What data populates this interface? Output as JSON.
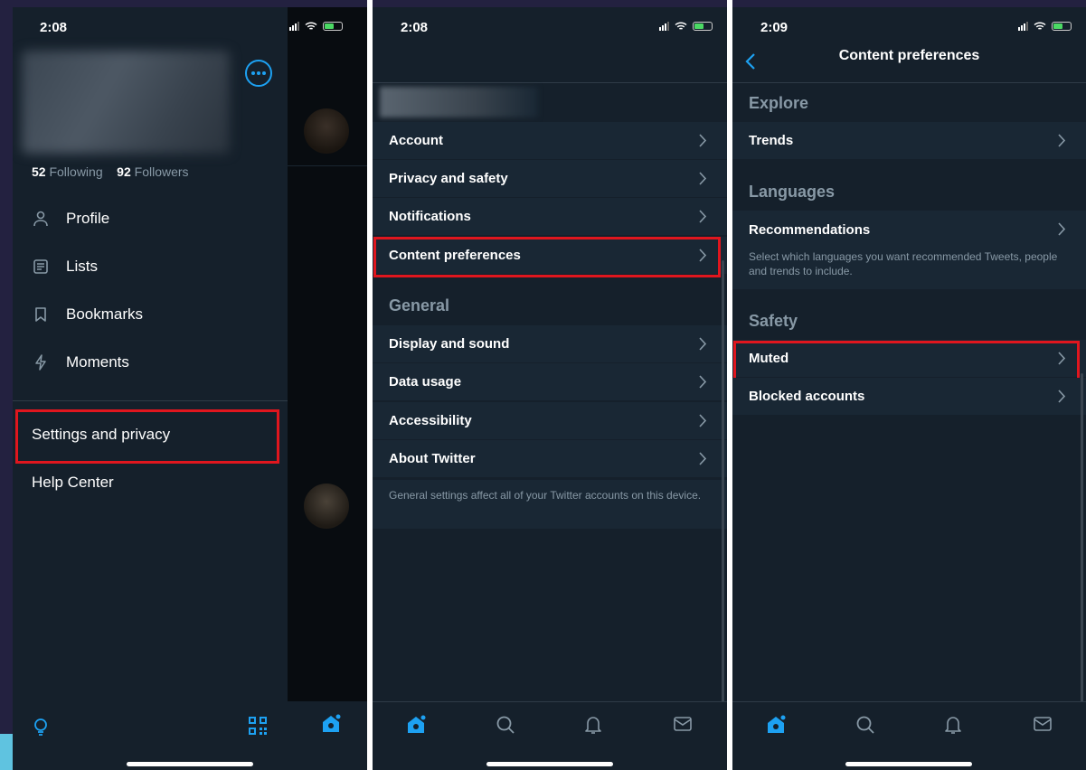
{
  "colors": {
    "background": "#15202b",
    "row": "#192734",
    "accent": "#1da1f2",
    "highlight": "#e0161e",
    "muted_text": "#8899a6"
  },
  "panel1": {
    "time": "2:08",
    "following_count": "52",
    "following_label": "Following",
    "followers_count": "92",
    "followers_label": "Followers",
    "menu": [
      {
        "label": "Profile",
        "icon": "person-icon"
      },
      {
        "label": "Lists",
        "icon": "list-icon"
      },
      {
        "label": "Bookmarks",
        "icon": "bookmark-icon"
      },
      {
        "label": "Moments",
        "icon": "lightning-icon"
      }
    ],
    "settings_label": "Settings and privacy",
    "help_label": "Help Center",
    "bottom_icons": [
      "lightbulb-icon",
      "qr-code-icon"
    ]
  },
  "panel2": {
    "time": "2:08",
    "rows": [
      {
        "label": "Account"
      },
      {
        "label": "Privacy and safety"
      },
      {
        "label": "Notifications"
      },
      {
        "label": "Content preferences"
      }
    ],
    "general_header": "General",
    "general_rows": [
      {
        "label": "Display and sound"
      },
      {
        "label": "Data usage"
      },
      {
        "label": "Accessibility"
      },
      {
        "label": "About Twitter"
      }
    ],
    "general_note": "General settings affect all of your Twitter accounts on this device.",
    "tab_icons": [
      "home-icon",
      "search-icon",
      "bell-icon",
      "mail-icon"
    ]
  },
  "panel3": {
    "time": "2:09",
    "title": "Content preferences",
    "explore_header": "Explore",
    "trends_label": "Trends",
    "languages_header": "Languages",
    "recommendations_label": "Recommendations",
    "recommendations_note": "Select which languages you want recommended Tweets, people and trends to include.",
    "safety_header": "Safety",
    "muted_label": "Muted",
    "blocked_label": "Blocked accounts"
  }
}
